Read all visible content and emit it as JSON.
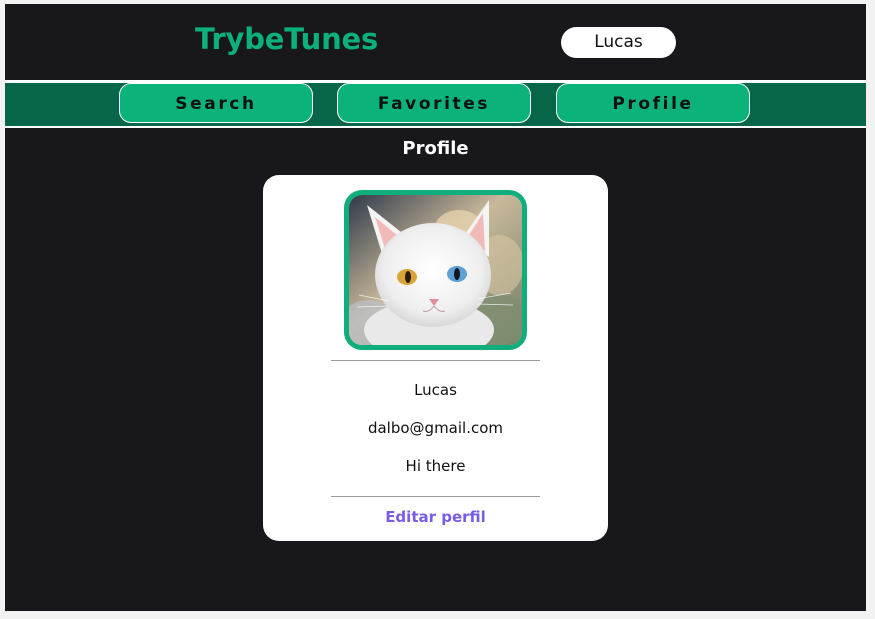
{
  "header": {
    "logo": "TrybeTunes",
    "user_name": "Lucas"
  },
  "nav": {
    "items": [
      {
        "label": "Search"
      },
      {
        "label": "Favorites"
      },
      {
        "label": "Profile"
      }
    ]
  },
  "page": {
    "title": "Profile"
  },
  "profile": {
    "name": "Lucas",
    "email": "dalbo@gmail.com",
    "description": "Hi there",
    "edit_link": "Editar perfil"
  },
  "colors": {
    "accent": "#0cb07b",
    "nav_bar": "#07664a",
    "background": "#17171c",
    "link": "#7b5ce6"
  }
}
